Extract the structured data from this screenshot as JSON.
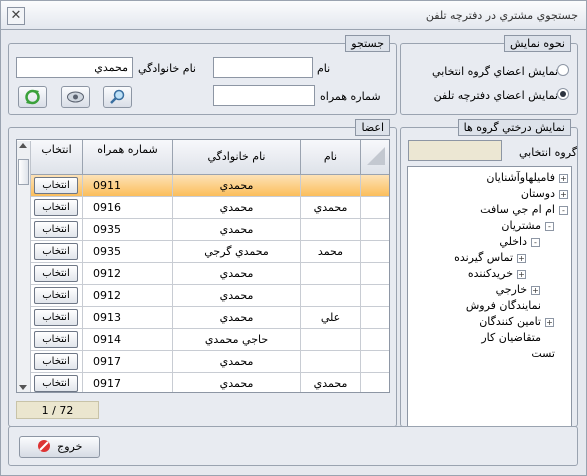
{
  "window": {
    "title": "جستجوي مشتري در دفترچه تلفن",
    "close_glyph": "✕"
  },
  "display_mode": {
    "caption": "نحوه نمايش",
    "options": [
      {
        "label": "نمايش اعضاي گروه انتخابي",
        "selected": false
      },
      {
        "label": "نمايش اعضاي دفترچه تلفن",
        "selected": true
      }
    ]
  },
  "search": {
    "caption": "جستجو",
    "name_label": "نام",
    "family_label": "نام خانوادگي",
    "mobile_label": "شماره همراه",
    "name_value": "",
    "family_value": "محمدي",
    "mobile_value": ""
  },
  "members": {
    "caption": "اعضا",
    "headers": {
      "name": "نام",
      "family": "نام خانوادگي",
      "mobile": "شماره همراه",
      "select": "انتخاب"
    },
    "select_label": "انتخاب",
    "rows": [
      {
        "name": "",
        "family": "محمدي",
        "mobile": "0911",
        "selected": true
      },
      {
        "name": "محمدي",
        "family": "محمدي",
        "mobile": "0916",
        "selected": false
      },
      {
        "name": "",
        "family": "محمدي",
        "mobile": "0935",
        "selected": false
      },
      {
        "name": "محمد",
        "family": "محمدي گرجي",
        "mobile": "0935",
        "selected": false
      },
      {
        "name": "",
        "family": "محمدي",
        "mobile": "0912",
        "selected": false
      },
      {
        "name": "",
        "family": "محمدي",
        "mobile": "0912",
        "selected": false
      },
      {
        "name": "علي",
        "family": "محمدي",
        "mobile": "0913",
        "selected": false
      },
      {
        "name": "",
        "family": "حاجي محمدي",
        "mobile": "0914",
        "selected": false
      },
      {
        "name": "",
        "family": "محمدي",
        "mobile": "0917",
        "selected": false
      },
      {
        "name": "محمدي",
        "family": "محمدي",
        "mobile": "0917",
        "selected": false
      }
    ],
    "pager": "1 / 72"
  },
  "groups": {
    "caption": "نمايش درختي گروه ها",
    "selected_label": "گروه انتخابي",
    "selected_value": "",
    "tree": [
      {
        "label": "فاميلهاوآشنايان",
        "level": 0,
        "expander": "+"
      },
      {
        "label": "دوستان",
        "level": 0,
        "expander": "+"
      },
      {
        "label": "ام ام جي سافت",
        "level": 0,
        "expander": "-"
      },
      {
        "label": "مشتريان",
        "level": 1,
        "expander": "-"
      },
      {
        "label": "داخلي",
        "level": 2,
        "expander": "-"
      },
      {
        "label": "تماس گيرنده",
        "level": 3,
        "expander": "+"
      },
      {
        "label": "خريدكننده",
        "level": 3,
        "expander": "+"
      },
      {
        "label": "خارجي",
        "level": 2,
        "expander": "+"
      },
      {
        "label": "نمايندگان فروش",
        "level": 1,
        "expander": ""
      },
      {
        "label": "تامين كنندگان",
        "level": 1,
        "expander": "+"
      },
      {
        "label": "متقاضيان كار",
        "level": 1,
        "expander": ""
      },
      {
        "label": "تست",
        "level": 0,
        "expander": ""
      }
    ]
  },
  "exit_label": "خروج",
  "icons": {
    "refresh": "refresh-icon",
    "view": "view-icon",
    "search": "search-icon",
    "exit": "exit-icon"
  }
}
